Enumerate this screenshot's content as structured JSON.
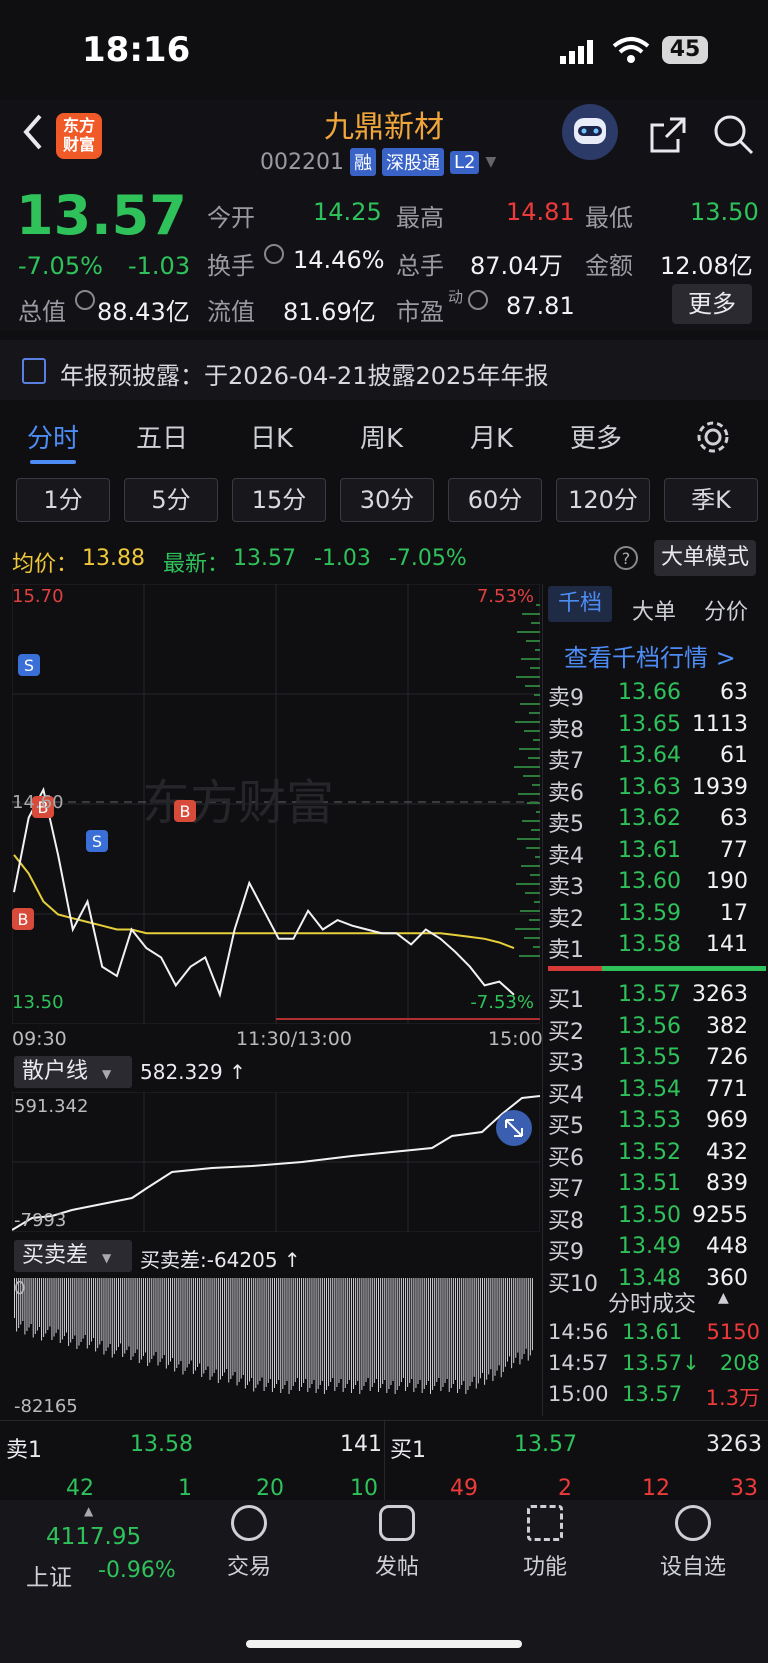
{
  "status_bar": {
    "time": "18:16",
    "battery": "45"
  },
  "header": {
    "logo_text": "东方财富",
    "stock_name": "九鼎新材",
    "code": "002201",
    "tags": [
      "融",
      "深股通",
      "L2"
    ]
  },
  "quote": {
    "price": "13.57",
    "change_pct": "-7.05%",
    "change": "-1.03",
    "open_label": "今开",
    "open": "14.25",
    "high_label": "最高",
    "high": "14.81",
    "low_label": "最低",
    "low": "13.50",
    "turnover_label": "换手",
    "turnover": "14.46%",
    "volume_label": "总手",
    "volume": "87.04万",
    "amount_label": "金额",
    "amount": "12.08亿",
    "mktcap_label": "总值",
    "mktcap": "88.43亿",
    "float_label": "流值",
    "float": "81.69亿",
    "pe_label": "市盈",
    "pe_sup": "动",
    "pe": "87.81",
    "more_label": "更多"
  },
  "notice": {
    "text": "年报预披露：于2026-04-21披露2025年年报"
  },
  "tabs": [
    "分时",
    "五日",
    "日K",
    "周K",
    "月K",
    "更多"
  ],
  "subtabs": [
    "1分",
    "5分",
    "15分",
    "30分",
    "60分",
    "120分",
    "季K"
  ],
  "info_line": {
    "avg_label": "均价：",
    "avg": "13.88",
    "last_label": "最新：",
    "last": "13.57",
    "chg": "-1.03",
    "pct": "-7.05%",
    "mode_button": "大单模式"
  },
  "chart_data": {
    "type": "line",
    "y_top": "15.70",
    "y_bottom": "13.50",
    "y_mid": "14.60",
    "pct_top": "7.53%",
    "pct_bottom": "-7.53%",
    "x_labels": [
      "09:30",
      "11:30/13:00",
      "15:00"
    ],
    "watermark": "东方财富",
    "markers": [
      "S",
      "B",
      "S",
      "B",
      "B"
    ],
    "series": [
      {
        "values": [
          14.1,
          14.5,
          14.65,
          14.3,
          13.9,
          14.05,
          13.7,
          13.65,
          13.9,
          13.8,
          13.75,
          13.6,
          13.7,
          13.75,
          13.55,
          13.9,
          14.15,
          14.0,
          13.85,
          13.85,
          14.0,
          13.9,
          13.95,
          13.92,
          13.9,
          13.88,
          13.88,
          13.82,
          13.9,
          13.85,
          13.78,
          13.7,
          13.6,
          13.62,
          13.55
        ]
      },
      {
        "values": [
          14.3,
          14.2,
          14.05,
          13.98,
          13.96,
          13.94,
          13.92,
          13.9,
          13.9,
          13.88,
          13.88,
          13.88,
          13.88,
          13.88,
          13.88,
          13.88,
          13.88,
          13.88,
          13.88,
          13.88,
          13.88,
          13.88,
          13.88,
          13.88,
          13.88,
          13.88,
          13.88,
          13.88,
          13.88,
          13.88,
          13.87,
          13.86,
          13.85,
          13.83,
          13.8
        ]
      }
    ]
  },
  "retail_panel": {
    "label": "散户线",
    "value": "582.329 ↑",
    "top": "591.342",
    "bottom": "-7993"
  },
  "diff_panel": {
    "label": "买卖差",
    "value": "买卖差:-64205 ↑",
    "top": "0",
    "bottom": "-82165"
  },
  "book_tabs": [
    "千档",
    "大单",
    "分价"
  ],
  "book_link": "查看千档行情 >",
  "asks": [
    {
      "label": "卖9",
      "price": "13.66",
      "vol": "63"
    },
    {
      "label": "卖8",
      "price": "13.65",
      "vol": "1113"
    },
    {
      "label": "卖7",
      "price": "13.64",
      "vol": "61"
    },
    {
      "label": "卖6",
      "price": "13.63",
      "vol": "1939"
    },
    {
      "label": "卖5",
      "price": "13.62",
      "vol": "63"
    },
    {
      "label": "卖4",
      "price": "13.61",
      "vol": "77"
    },
    {
      "label": "卖3",
      "price": "13.60",
      "vol": "190"
    },
    {
      "label": "卖2",
      "price": "13.59",
      "vol": "17"
    },
    {
      "label": "卖1",
      "price": "13.58",
      "vol": "141"
    }
  ],
  "bids": [
    {
      "label": "买1",
      "price": "13.57",
      "vol": "3263"
    },
    {
      "label": "买2",
      "price": "13.56",
      "vol": "382"
    },
    {
      "label": "买3",
      "price": "13.55",
      "vol": "726"
    },
    {
      "label": "买4",
      "price": "13.54",
      "vol": "771"
    },
    {
      "label": "买5",
      "price": "13.53",
      "vol": "969"
    },
    {
      "label": "买6",
      "price": "13.52",
      "vol": "432"
    },
    {
      "label": "买7",
      "price": "13.51",
      "vol": "839"
    },
    {
      "label": "买8",
      "price": "13.50",
      "vol": "9255"
    },
    {
      "label": "买9",
      "price": "13.49",
      "vol": "448"
    },
    {
      "label": "买10",
      "price": "13.48",
      "vol": "360"
    }
  ],
  "trades_header": "分时成交",
  "trades": [
    {
      "time": "14:56",
      "price": "13.61",
      "vol": "5150"
    },
    {
      "time": "14:57",
      "price": "13.57↓",
      "vol": "208"
    },
    {
      "time": "15:00",
      "price": "13.57",
      "vol": "1.3万"
    }
  ],
  "bottom_quote": {
    "sell_label": "卖1",
    "sell_price": "13.58",
    "sell_vol": "141",
    "buy_label": "买1",
    "buy_price": "13.57",
    "buy_vol": "3263",
    "left_nums": [
      "42",
      "1",
      "20",
      "10"
    ],
    "right_nums": [
      "49",
      "2",
      "12",
      "33"
    ]
  },
  "bottom_nav": {
    "index_value": "4117.95",
    "index_name": "上证",
    "index_pct": "-0.96%",
    "items": [
      "交易",
      "发帖",
      "功能",
      "设自选"
    ]
  }
}
